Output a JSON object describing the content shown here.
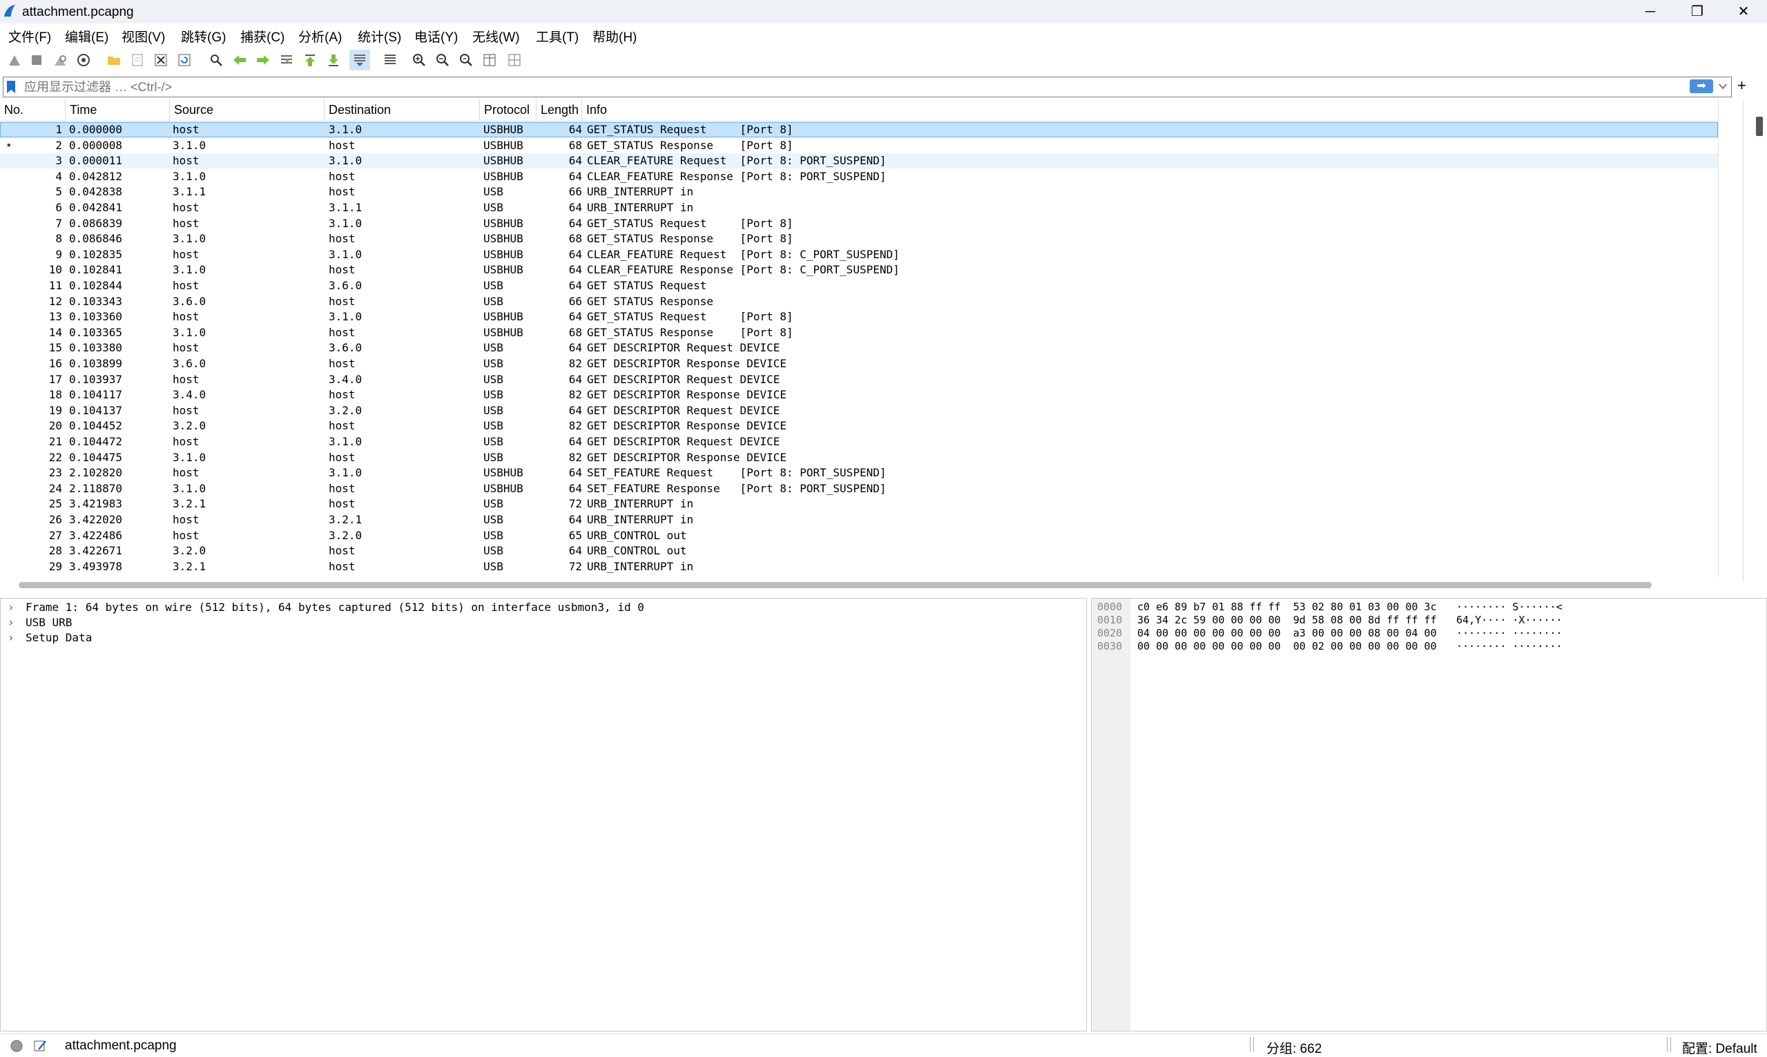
{
  "window": {
    "title": "attachment.pcapng",
    "minimize": "─",
    "maximize": "❐",
    "close": "✕"
  },
  "menu": [
    "文件(F)",
    "编辑(E)",
    "视图(V)",
    "跳转(G)",
    "捕获(C)",
    "分析(A)",
    "统计(S)",
    "电话(Y)",
    "无线(W)",
    "工具(T)",
    "帮助(H)"
  ],
  "toolbar_icons": [
    "start-capture-icon",
    "stop-capture-icon",
    "restart-capture-icon",
    "capture-options-icon",
    "open-file-icon",
    "save-file-icon",
    "close-file-icon",
    "reload-file-icon",
    "find-packet-icon",
    "go-back-icon",
    "go-forward-icon",
    "go-to-packet-icon",
    "first-packet-icon",
    "last-packet-icon",
    "auto-scroll-icon",
    "colorize-icon",
    "zoom-in-icon",
    "zoom-out-icon",
    "normal-size-icon",
    "resize-columns-icon",
    "layout-icon"
  ],
  "filter": {
    "placeholder": "应用显示过滤器 … <Ctrl-/>",
    "apply": "➡",
    "add": "+"
  },
  "columns": [
    "No.",
    "Time",
    "Source",
    "Destination",
    "Protocol",
    "Length",
    "Info"
  ],
  "packets": [
    [
      "1",
      "0.000000",
      "host",
      "3.1.0",
      "USBHUB",
      "64",
      "GET_STATUS Request     [Port 8]"
    ],
    [
      "2",
      "0.000008",
      "3.1.0",
      "host",
      "USBHUB",
      "68",
      "GET_STATUS Response    [Port 8]"
    ],
    [
      "3",
      "0.000011",
      "host",
      "3.1.0",
      "USBHUB",
      "64",
      "CLEAR_FEATURE Request  [Port 8: PORT_SUSPEND]"
    ],
    [
      "4",
      "0.042812",
      "3.1.0",
      "host",
      "USBHUB",
      "64",
      "CLEAR_FEATURE Response [Port 8: PORT_SUSPEND]"
    ],
    [
      "5",
      "0.042838",
      "3.1.1",
      "host",
      "USB",
      "66",
      "URB_INTERRUPT in"
    ],
    [
      "6",
      "0.042841",
      "host",
      "3.1.1",
      "USB",
      "64",
      "URB_INTERRUPT in"
    ],
    [
      "7",
      "0.086839",
      "host",
      "3.1.0",
      "USBHUB",
      "64",
      "GET_STATUS Request     [Port 8]"
    ],
    [
      "8",
      "0.086846",
      "3.1.0",
      "host",
      "USBHUB",
      "68",
      "GET_STATUS Response    [Port 8]"
    ],
    [
      "9",
      "0.102835",
      "host",
      "3.1.0",
      "USBHUB",
      "64",
      "CLEAR_FEATURE Request  [Port 8: C_PORT_SUSPEND]"
    ],
    [
      "10",
      "0.102841",
      "3.1.0",
      "host",
      "USBHUB",
      "64",
      "CLEAR_FEATURE Response [Port 8: C_PORT_SUSPEND]"
    ],
    [
      "11",
      "0.102844",
      "host",
      "3.6.0",
      "USB",
      "64",
      "GET STATUS Request"
    ],
    [
      "12",
      "0.103343",
      "3.6.0",
      "host",
      "USB",
      "66",
      "GET STATUS Response"
    ],
    [
      "13",
      "0.103360",
      "host",
      "3.1.0",
      "USBHUB",
      "64",
      "GET_STATUS Request     [Port 8]"
    ],
    [
      "14",
      "0.103365",
      "3.1.0",
      "host",
      "USBHUB",
      "68",
      "GET_STATUS Response    [Port 8]"
    ],
    [
      "15",
      "0.103380",
      "host",
      "3.6.0",
      "USB",
      "64",
      "GET DESCRIPTOR Request DEVICE"
    ],
    [
      "16",
      "0.103899",
      "3.6.0",
      "host",
      "USB",
      "82",
      "GET DESCRIPTOR Response DEVICE"
    ],
    [
      "17",
      "0.103937",
      "host",
      "3.4.0",
      "USB",
      "64",
      "GET DESCRIPTOR Request DEVICE"
    ],
    [
      "18",
      "0.104117",
      "3.4.0",
      "host",
      "USB",
      "82",
      "GET DESCRIPTOR Response DEVICE"
    ],
    [
      "19",
      "0.104137",
      "host",
      "3.2.0",
      "USB",
      "64",
      "GET DESCRIPTOR Request DEVICE"
    ],
    [
      "20",
      "0.104452",
      "3.2.0",
      "host",
      "USB",
      "82",
      "GET DESCRIPTOR Response DEVICE"
    ],
    [
      "21",
      "0.104472",
      "host",
      "3.1.0",
      "USB",
      "64",
      "GET DESCRIPTOR Request DEVICE"
    ],
    [
      "22",
      "0.104475",
      "3.1.0",
      "host",
      "USB",
      "82",
      "GET DESCRIPTOR Response DEVICE"
    ],
    [
      "23",
      "2.102820",
      "host",
      "3.1.0",
      "USBHUB",
      "64",
      "SET_FEATURE Request    [Port 8: PORT_SUSPEND]"
    ],
    [
      "24",
      "2.118870",
      "3.1.0",
      "host",
      "USBHUB",
      "64",
      "SET_FEATURE Response   [Port 8: PORT_SUSPEND]"
    ],
    [
      "25",
      "3.421983",
      "3.2.1",
      "host",
      "USB",
      "72",
      "URB_INTERRUPT in"
    ],
    [
      "26",
      "3.422020",
      "host",
      "3.2.1",
      "USB",
      "64",
      "URB_INTERRUPT in"
    ],
    [
      "27",
      "3.422486",
      "host",
      "3.2.0",
      "USB",
      "65",
      "URB_CONTROL out"
    ],
    [
      "28",
      "3.422671",
      "3.2.0",
      "host",
      "USB",
      "64",
      "URB_CONTROL out"
    ],
    [
      "29",
      "3.493978",
      "3.2.1",
      "host",
      "USB",
      "72",
      "URB_INTERRUPT in"
    ]
  ],
  "details": [
    "Frame 1: 64 bytes on wire (512 bits), 64 bytes captured (512 bits) on interface usbmon3, id 0",
    "USB URB",
    "Setup Data"
  ],
  "bytes": [
    {
      "offset": "0000",
      "hex": "c0 e6 89 b7 01 88 ff ff  53 02 80 01 03 00 00 3c",
      "ascii": "········ S······<"
    },
    {
      "offset": "0010",
      "hex": "36 34 2c 59 00 00 00 00  9d 58 08 00 8d ff ff ff",
      "ascii": "64,Y···· ·X······"
    },
    {
      "offset": "0020",
      "hex": "04 00 00 00 00 00 00 00  a3 00 00 00 08 00 04 00",
      "ascii": "········ ········"
    },
    {
      "offset": "0030",
      "hex": "00 00 00 00 00 00 00 00  00 02 00 00 00 00 00 00",
      "ascii": "········ ········"
    }
  ],
  "status": {
    "file": "attachment.pcapng",
    "packets": "分组: 662",
    "profile": "配置: Default"
  },
  "colors": {
    "selected_row": "#c5e2fb",
    "related_row": "#eaf4fd",
    "accent": "#1a6fd0"
  }
}
